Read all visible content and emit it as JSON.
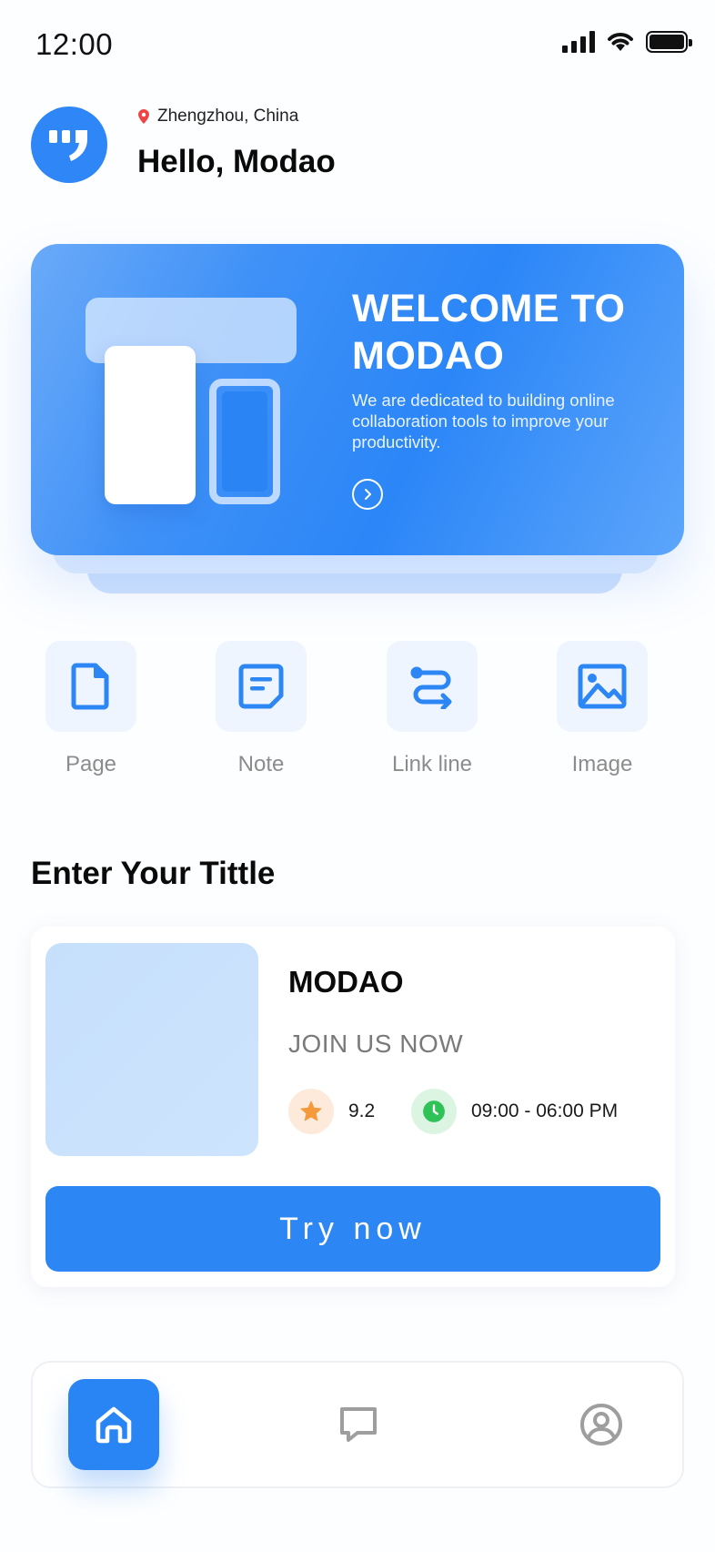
{
  "status_bar": {
    "time": "12:00"
  },
  "header": {
    "location": "Zhengzhou, China",
    "greeting": "Hello, Modao"
  },
  "banner": {
    "title": "WELCOME TO MODAO",
    "description": "We are dedicated to building online collaboration tools to improve your productivity."
  },
  "quick_actions": [
    {
      "label": "Page",
      "icon": "page-icon"
    },
    {
      "label": "Note",
      "icon": "note-icon"
    },
    {
      "label": "Link line",
      "icon": "link-line-icon"
    },
    {
      "label": "Image",
      "icon": "image-icon"
    }
  ],
  "section": {
    "title": "Enter Your Tittle"
  },
  "card": {
    "title": "MODAO",
    "subtitle": "JOIN US NOW",
    "rating": "9.2",
    "hours": "09:00 - 06:00 PM",
    "button_label": "Try now"
  },
  "tab_bar": {
    "tabs": [
      {
        "name": "home",
        "icon": "home-icon",
        "active": true
      },
      {
        "name": "messages",
        "icon": "message-icon",
        "active": false
      },
      {
        "name": "profile",
        "icon": "user-icon",
        "active": false
      }
    ]
  },
  "colors": {
    "primary": "#2c86f4",
    "tile_bg": "#eef5fe",
    "star": "#f59a3b",
    "clock": "#2fc257",
    "location_pin": "#ef4444"
  }
}
